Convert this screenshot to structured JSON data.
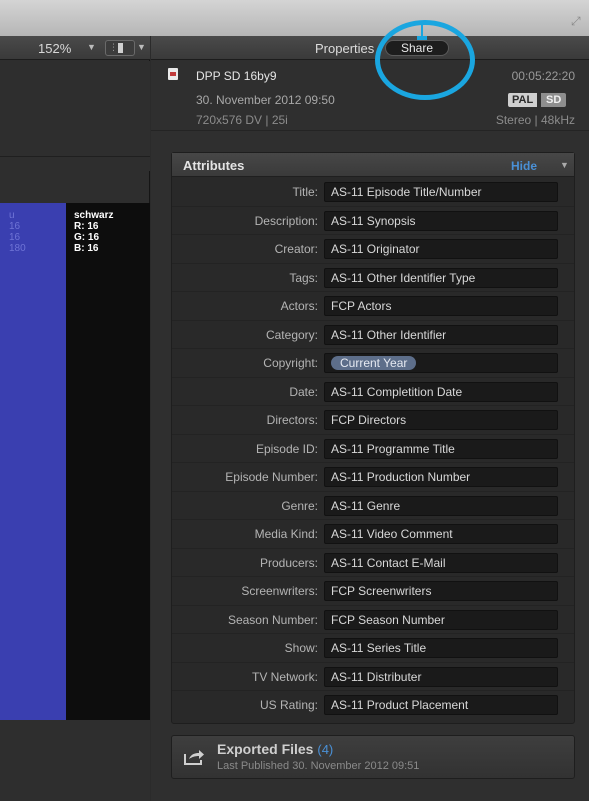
{
  "viewer": {
    "zoom": "152%",
    "color_readout": {
      "left_lines": [
        "u",
        "16",
        "16",
        "180"
      ],
      "swatch_name": "schwarz",
      "swatch_lines": [
        "R: 16",
        "G: 16",
        "B: 16"
      ]
    }
  },
  "inspector": {
    "tabs": {
      "properties": "Properties",
      "share": "Share"
    },
    "clip": {
      "name": "DPP SD 16by9",
      "duration": "00:05:22:20",
      "date": "30. November 2012 09:50",
      "badge_pal": "PAL",
      "badge_sd": "SD",
      "format": "720x576 DV  |  25i",
      "audio": "Stereo  |  48kHz"
    },
    "attributes": {
      "title": "Attributes",
      "hide_label": "Hide",
      "rows": [
        {
          "label": "Title:",
          "value": "AS-11 Episode Title/Number"
        },
        {
          "label": "Description:",
          "value": "AS-11 Synopsis"
        },
        {
          "label": "Creator:",
          "value": "AS-11 Originator"
        },
        {
          "label": "Tags:",
          "value": "AS-11 Other Identifier Type"
        },
        {
          "label": "Actors:",
          "value": "FCP Actors"
        },
        {
          "label": "Category:",
          "value": "AS-11 Other Identifier"
        },
        {
          "label": "Copyright:",
          "value": "Current Year"
        },
        {
          "label": "Date:",
          "value": "AS-11 Completition Date"
        },
        {
          "label": "Directors:",
          "value": "FCP Directors"
        },
        {
          "label": "Episode ID:",
          "value": "AS-11 Programme Title"
        },
        {
          "label": "Episode Number:",
          "value": "AS-11 Production Number"
        },
        {
          "label": "Genre:",
          "value": "AS-11 Genre"
        },
        {
          "label": "Media Kind:",
          "value": "AS-11 Video Comment"
        },
        {
          "label": "Producers:",
          "value": "AS-11 Contact E-Mail"
        },
        {
          "label": "Screenwriters:",
          "value": "FCP Screenwriters"
        },
        {
          "label": "Season Number:",
          "value": "FCP Season Number"
        },
        {
          "label": "Show:",
          "value": "AS-11 Series Title"
        },
        {
          "label": "TV Network:",
          "value": "AS-11 Distributer"
        },
        {
          "label": "US Rating:",
          "value": "AS-11 Product Placement"
        }
      ]
    },
    "exported": {
      "title": "Exported Files",
      "count": "(4)",
      "subtitle": "Last Published 30. November 2012 09:51"
    }
  },
  "colors": {
    "highlight_ring": "#1aa6e0",
    "accent_blue": "#4a90d6",
    "swatch_blue": "#3a3fb0"
  },
  "icons": [
    "resize-grip-icon",
    "chevron-down-icon",
    "document-icon",
    "share-icon",
    "highlight-ring"
  ]
}
